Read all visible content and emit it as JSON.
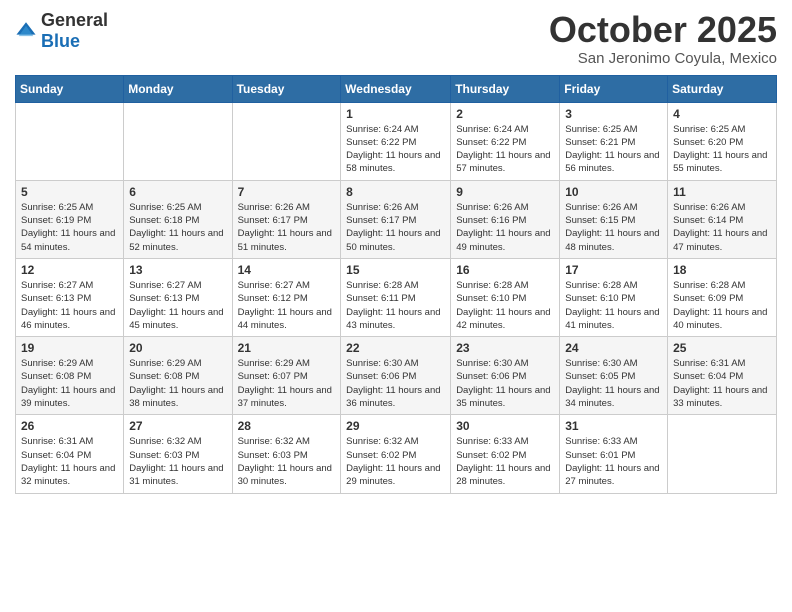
{
  "header": {
    "logo_general": "General",
    "logo_blue": "Blue",
    "month": "October 2025",
    "location": "San Jeronimo Coyula, Mexico"
  },
  "weekdays": [
    "Sunday",
    "Monday",
    "Tuesday",
    "Wednesday",
    "Thursday",
    "Friday",
    "Saturday"
  ],
  "weeks": [
    [
      {
        "day": "",
        "info": ""
      },
      {
        "day": "",
        "info": ""
      },
      {
        "day": "",
        "info": ""
      },
      {
        "day": "1",
        "info": "Sunrise: 6:24 AM\nSunset: 6:22 PM\nDaylight: 11 hours and 58 minutes."
      },
      {
        "day": "2",
        "info": "Sunrise: 6:24 AM\nSunset: 6:22 PM\nDaylight: 11 hours and 57 minutes."
      },
      {
        "day": "3",
        "info": "Sunrise: 6:25 AM\nSunset: 6:21 PM\nDaylight: 11 hours and 56 minutes."
      },
      {
        "day": "4",
        "info": "Sunrise: 6:25 AM\nSunset: 6:20 PM\nDaylight: 11 hours and 55 minutes."
      }
    ],
    [
      {
        "day": "5",
        "info": "Sunrise: 6:25 AM\nSunset: 6:19 PM\nDaylight: 11 hours and 54 minutes."
      },
      {
        "day": "6",
        "info": "Sunrise: 6:25 AM\nSunset: 6:18 PM\nDaylight: 11 hours and 52 minutes."
      },
      {
        "day": "7",
        "info": "Sunrise: 6:26 AM\nSunset: 6:17 PM\nDaylight: 11 hours and 51 minutes."
      },
      {
        "day": "8",
        "info": "Sunrise: 6:26 AM\nSunset: 6:17 PM\nDaylight: 11 hours and 50 minutes."
      },
      {
        "day": "9",
        "info": "Sunrise: 6:26 AM\nSunset: 6:16 PM\nDaylight: 11 hours and 49 minutes."
      },
      {
        "day": "10",
        "info": "Sunrise: 6:26 AM\nSunset: 6:15 PM\nDaylight: 11 hours and 48 minutes."
      },
      {
        "day": "11",
        "info": "Sunrise: 6:26 AM\nSunset: 6:14 PM\nDaylight: 11 hours and 47 minutes."
      }
    ],
    [
      {
        "day": "12",
        "info": "Sunrise: 6:27 AM\nSunset: 6:13 PM\nDaylight: 11 hours and 46 minutes."
      },
      {
        "day": "13",
        "info": "Sunrise: 6:27 AM\nSunset: 6:13 PM\nDaylight: 11 hours and 45 minutes."
      },
      {
        "day": "14",
        "info": "Sunrise: 6:27 AM\nSunset: 6:12 PM\nDaylight: 11 hours and 44 minutes."
      },
      {
        "day": "15",
        "info": "Sunrise: 6:28 AM\nSunset: 6:11 PM\nDaylight: 11 hours and 43 minutes."
      },
      {
        "day": "16",
        "info": "Sunrise: 6:28 AM\nSunset: 6:10 PM\nDaylight: 11 hours and 42 minutes."
      },
      {
        "day": "17",
        "info": "Sunrise: 6:28 AM\nSunset: 6:10 PM\nDaylight: 11 hours and 41 minutes."
      },
      {
        "day": "18",
        "info": "Sunrise: 6:28 AM\nSunset: 6:09 PM\nDaylight: 11 hours and 40 minutes."
      }
    ],
    [
      {
        "day": "19",
        "info": "Sunrise: 6:29 AM\nSunset: 6:08 PM\nDaylight: 11 hours and 39 minutes."
      },
      {
        "day": "20",
        "info": "Sunrise: 6:29 AM\nSunset: 6:08 PM\nDaylight: 11 hours and 38 minutes."
      },
      {
        "day": "21",
        "info": "Sunrise: 6:29 AM\nSunset: 6:07 PM\nDaylight: 11 hours and 37 minutes."
      },
      {
        "day": "22",
        "info": "Sunrise: 6:30 AM\nSunset: 6:06 PM\nDaylight: 11 hours and 36 minutes."
      },
      {
        "day": "23",
        "info": "Sunrise: 6:30 AM\nSunset: 6:06 PM\nDaylight: 11 hours and 35 minutes."
      },
      {
        "day": "24",
        "info": "Sunrise: 6:30 AM\nSunset: 6:05 PM\nDaylight: 11 hours and 34 minutes."
      },
      {
        "day": "25",
        "info": "Sunrise: 6:31 AM\nSunset: 6:04 PM\nDaylight: 11 hours and 33 minutes."
      }
    ],
    [
      {
        "day": "26",
        "info": "Sunrise: 6:31 AM\nSunset: 6:04 PM\nDaylight: 11 hours and 32 minutes."
      },
      {
        "day": "27",
        "info": "Sunrise: 6:32 AM\nSunset: 6:03 PM\nDaylight: 11 hours and 31 minutes."
      },
      {
        "day": "28",
        "info": "Sunrise: 6:32 AM\nSunset: 6:03 PM\nDaylight: 11 hours and 30 minutes."
      },
      {
        "day": "29",
        "info": "Sunrise: 6:32 AM\nSunset: 6:02 PM\nDaylight: 11 hours and 29 minutes."
      },
      {
        "day": "30",
        "info": "Sunrise: 6:33 AM\nSunset: 6:02 PM\nDaylight: 11 hours and 28 minutes."
      },
      {
        "day": "31",
        "info": "Sunrise: 6:33 AM\nSunset: 6:01 PM\nDaylight: 11 hours and 27 minutes."
      },
      {
        "day": "",
        "info": ""
      }
    ]
  ]
}
